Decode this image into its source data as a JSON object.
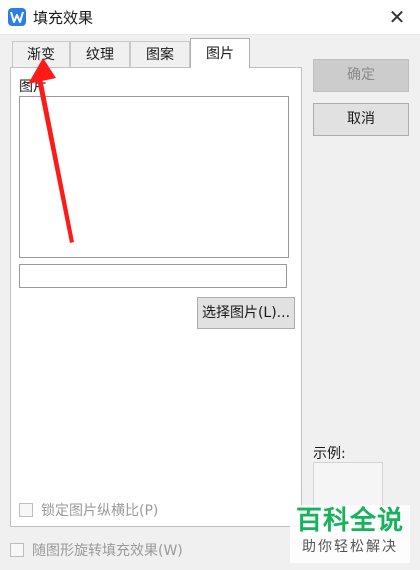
{
  "window": {
    "title": "填充效果"
  },
  "tabs": [
    {
      "label": "渐变",
      "active": false
    },
    {
      "label": "纹理",
      "active": false
    },
    {
      "label": "图案",
      "active": false
    },
    {
      "label": "图片",
      "active": true
    }
  ],
  "picture": {
    "group_label": "图片",
    "path_value": "",
    "select_button": "选择图片(L)...",
    "lock_ratio_label": "锁定图片纵横比(P)"
  },
  "rotate_with_shape_label": "随图形旋转填充效果(W)",
  "buttons": {
    "ok": "确定",
    "cancel": "取消"
  },
  "sample": {
    "label": "示例:"
  },
  "watermark": {
    "title": "百科全说",
    "subtitle": "助你轻松解决"
  },
  "colors": {
    "accent": "#2b7de9",
    "annotation": "#ff1a1a",
    "watermark_green": "#17b35c"
  }
}
